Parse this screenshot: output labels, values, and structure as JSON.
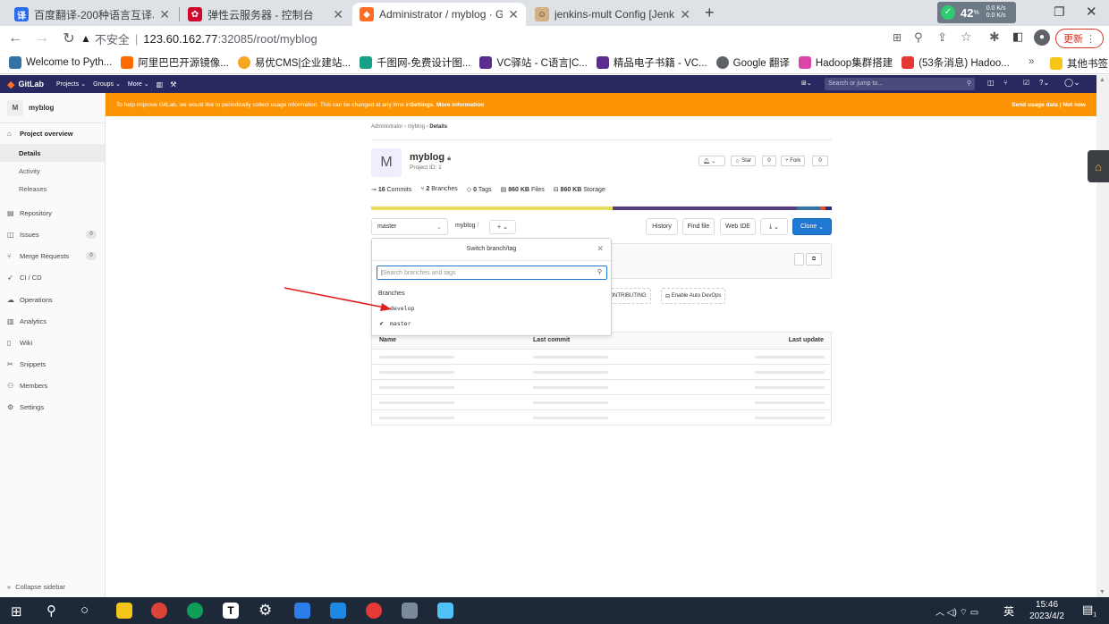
{
  "browser": {
    "tabs": [
      {
        "label": "百度翻译-200种语言互译、沟通",
        "icon": "baidu-translate-icon"
      },
      {
        "label": "弹性云服务器 - 控制台",
        "icon": "huawei-icon"
      },
      {
        "label": "Administrator / myblog · GitLab",
        "icon": "gitlab-icon"
      },
      {
        "label": "jenkins-mult Config [Jenkins]",
        "icon": "jenkins-icon"
      }
    ],
    "security_label": "不安全",
    "url_host": "123.60.162.77",
    "url_rest": ":32085/root/myblog",
    "update_label": "更新",
    "network_status": {
      "percent": "42",
      "up": "0.0 K/s",
      "down": "0.0 K/s"
    },
    "bookmarks": [
      {
        "label": "Welcome to Pyth...",
        "color": "#3572a5"
      },
      {
        "label": "阿里巴巴开源镜像...",
        "color": "#ff6a00"
      },
      {
        "label": "易优CMS|企业建站...",
        "color": "#f5a623"
      },
      {
        "label": "千图网-免费设计图...",
        "color": "#16a085"
      },
      {
        "label": "VC驿站 - C语言|C...",
        "color": "#5b2d8e"
      },
      {
        "label": "精品电子书籍 - VC...",
        "color": "#5b2d8e"
      },
      {
        "label": "Google 翻译",
        "color": "#5f6368"
      },
      {
        "label": "Hadoop集群搭建",
        "color": "#d946a8"
      },
      {
        "label": "(53条消息) Hadoo...",
        "color": "#e53935"
      }
    ],
    "bookmarks_more": "»",
    "other_bookmarks": "其他书签"
  },
  "gitlab": {
    "brand": "GitLab",
    "nav": [
      "Projects",
      "Groups",
      "More"
    ],
    "search_placeholder": "Search or jump to...",
    "banner": {
      "text": "To help improve GitLab, we would like to periodically collect usage information. This can be changed at any time in ",
      "settings_link": "Settings",
      "more_info": "More information",
      "send": "Send usage data",
      "not_now": "Not now"
    },
    "sidebar": {
      "project_avatar": "M",
      "project_name": "myblog",
      "items": [
        {
          "label": "Project overview",
          "icon": "home-icon"
        },
        {
          "label": "Details"
        },
        {
          "label": "Activity"
        },
        {
          "label": "Releases"
        },
        {
          "label": "Repository",
          "icon": "book-icon"
        },
        {
          "label": "Issues",
          "icon": "issues-icon",
          "count": "0"
        },
        {
          "label": "Merge Requests",
          "icon": "merge-icon",
          "count": "0"
        },
        {
          "label": "CI / CD",
          "icon": "rocket-icon"
        },
        {
          "label": "Operations",
          "icon": "cloud-icon"
        },
        {
          "label": "Analytics",
          "icon": "chart-icon"
        },
        {
          "label": "Wiki",
          "icon": "wiki-icon"
        },
        {
          "label": "Snippets",
          "icon": "scissors-icon"
        },
        {
          "label": "Members",
          "icon": "users-icon"
        },
        {
          "label": "Settings",
          "icon": "gear-icon"
        }
      ],
      "collapse": "Collapse sidebar"
    },
    "breadcrumb": [
      "Administrator",
      "myblog",
      "Details"
    ],
    "project": {
      "avatar": "M",
      "name": "myblog",
      "id_text": "Project ID: 1",
      "star_label": "Star",
      "star_count": "0",
      "fork_label": "Fork",
      "fork_count": "0"
    },
    "stats": {
      "commits_n": "16",
      "commits_label": "Commits",
      "branches_n": "2",
      "branches_label": "Branches",
      "tags_n": "0",
      "tags_label": "Tags",
      "files_n": "860 KB",
      "files_label": "Files",
      "storage_n": "860 KB",
      "storage_label": "Storage"
    },
    "language_bar": [
      {
        "color": "#e6dc60",
        "share": 0.525
      },
      {
        "color": "#563d7c",
        "share": 0.4
      },
      {
        "color": "#3572a5",
        "share": 0.05
      },
      {
        "color": "#e34c26",
        "share": 0.012
      },
      {
        "color": "#2b2b8a",
        "share": 0.013
      }
    ],
    "toolbar": {
      "branch": "master",
      "path": "myblog",
      "path_sep": "/",
      "add": "+",
      "history": "History",
      "find_file": "Find file",
      "web_ide": "Web IDE",
      "clone": "Clone"
    },
    "switcher": {
      "title": "Switch branch/tag",
      "search_placeholder": "Search branches and tags",
      "section": "Branches",
      "branches": [
        {
          "name": "develop",
          "checked": false
        },
        {
          "name": "master",
          "checked": true
        }
      ]
    },
    "quick_buttons": [
      "CONTRIBUTING",
      "Enable Auto DevOps"
    ],
    "table": {
      "headers": [
        "Name",
        "Last commit",
        "Last update"
      ],
      "row_count": 5
    }
  },
  "taskbar": {
    "time": "15:46",
    "date": "2023/4/2",
    "lang": "英",
    "notif": "1"
  }
}
